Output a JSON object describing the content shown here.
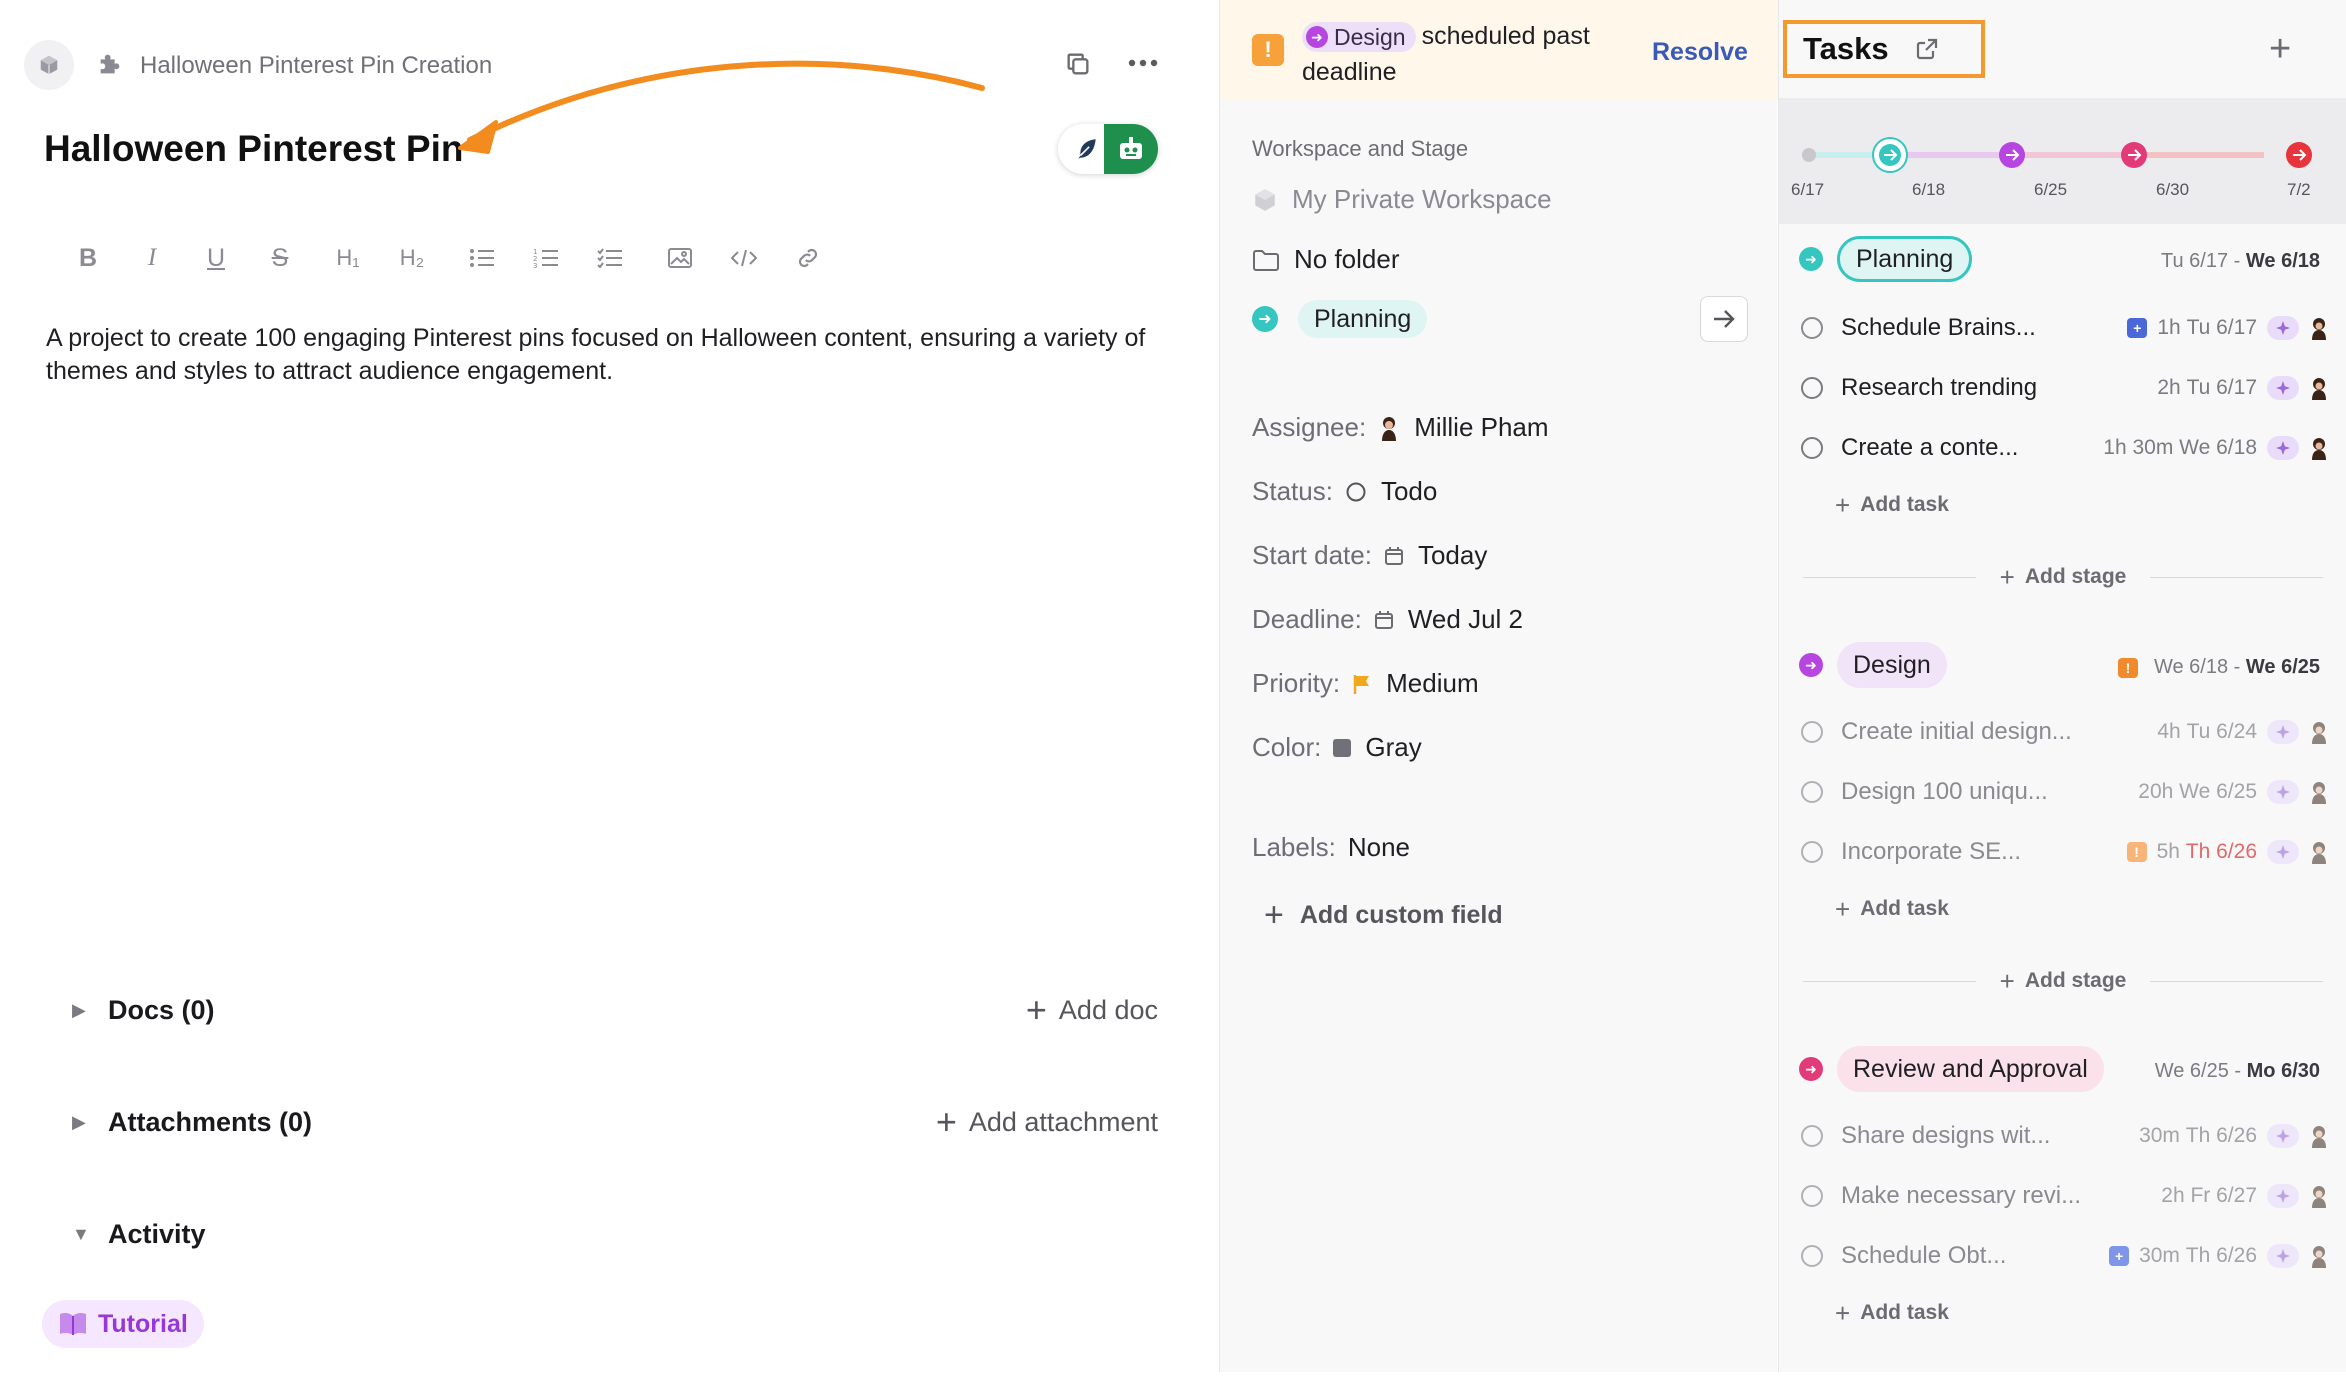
{
  "left": {
    "breadcrumb": "Halloween Pinterest Pin Creation",
    "title": "Halloween Pinterest Pin",
    "toolbar": [
      "B",
      "I",
      "U",
      "S",
      "H₁",
      "H₂",
      "bullet-list",
      "numbered-list",
      "checklist",
      "image",
      "code",
      "link"
    ],
    "description": "A project to create 100 engaging Pinterest pins focused on Halloween content, ensuring a variety of themes and styles to attract audience engagement.",
    "docs_label": "Docs (0)",
    "add_doc": "Add doc",
    "attachments_label": "Attachments (0)",
    "add_attachment": "Add attachment",
    "activity_label": "Activity",
    "tutorial_label": "Tutorial"
  },
  "middle": {
    "alert": {
      "stage": "Design",
      "text": "scheduled past deadline",
      "resolve": "Resolve",
      "badge": "!"
    },
    "workspace_label": "Workspace and Stage",
    "workspace": "My Private Workspace",
    "folder": "No folder",
    "stage": "Planning",
    "fields": {
      "assignee_k": "Assignee:",
      "assignee_v": "Millie Pham",
      "status_k": "Status:",
      "status_v": "Todo",
      "start_k": "Start date:",
      "start_v": "Today",
      "deadline_k": "Deadline:",
      "deadline_v": "Wed Jul 2",
      "priority_k": "Priority:",
      "priority_v": "Medium",
      "color_k": "Color:",
      "color_v": "Gray",
      "labels_k": "Labels:",
      "labels_v": "None"
    },
    "add_custom_field": "Add custom field"
  },
  "right": {
    "title": "Tasks",
    "timeline_labels": [
      "6/17",
      "6/18",
      "6/25",
      "6/30",
      "7/2"
    ],
    "add_task": "Add task",
    "add_stage": "Add stage",
    "stages": [
      {
        "name": "Planning",
        "dates_from": "Tu 6/17 -",
        "dates_to": "We 6/18",
        "color": "#35c6c0",
        "tasks": [
          {
            "name": "Schedule Brains...",
            "dur": "1h",
            "date": "Tu 6/17"
          },
          {
            "name": "Research trending ...",
            "dur": "2h",
            "date": "Tu 6/17"
          },
          {
            "name": "Create a conte...",
            "dur": "1h 30m",
            "date": "We 6/18"
          }
        ]
      },
      {
        "name": "Design",
        "dates_from": "We 6/18 -",
        "dates_to": "We 6/25",
        "color": "#b745e0",
        "tasks": [
          {
            "name": "Create initial design...",
            "dur": "4h",
            "date": "Tu 6/24"
          },
          {
            "name": "Design 100 uniqu...",
            "dur": "20h",
            "date": "We 6/25"
          },
          {
            "name": "Incorporate SE...",
            "dur": "5h",
            "date": "Th 6/26"
          }
        ]
      },
      {
        "name": "Review and Approval",
        "dates_from": "We 6/25 -",
        "dates_to": "Mo 6/30",
        "color": "#e23b7a",
        "tasks": [
          {
            "name": "Share designs wit...",
            "dur": "30m",
            "date": "Th 6/26"
          },
          {
            "name": "Make necessary revi...",
            "dur": "2h",
            "date": "Fr 6/27"
          },
          {
            "name": "Schedule Obt...",
            "dur": "30m",
            "date": "Th 6/26"
          }
        ]
      }
    ]
  }
}
